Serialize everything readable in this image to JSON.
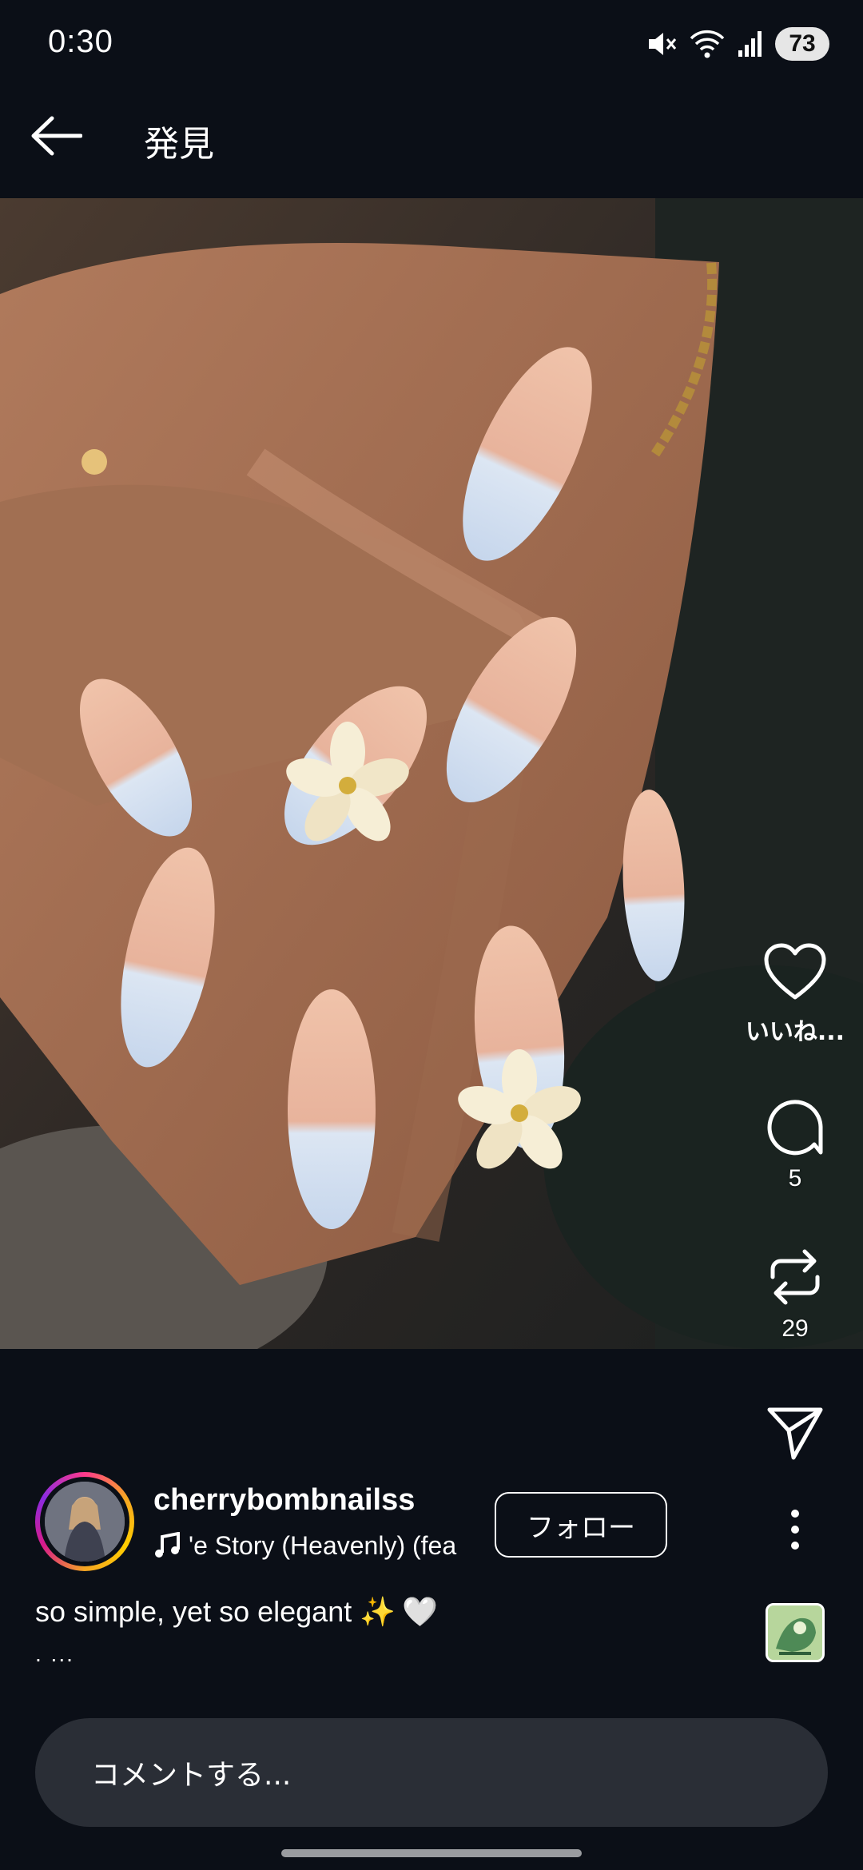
{
  "status_bar": {
    "time": "0:30",
    "battery": "73"
  },
  "header": {
    "title": "発見"
  },
  "actions": {
    "like_label": "いいね...",
    "comment_count": "5",
    "repost_count": "29"
  },
  "post": {
    "username": "cherrybombnailss",
    "music": "'e Story (Heavenly) (fea",
    "follow_label": "フォロー",
    "caption": "so simple, yet so elegant ✨",
    "caption_emoji": "🤍",
    "caption_more": ". ..."
  },
  "comment": {
    "placeholder": "コメントする..."
  },
  "colors": {
    "background": "#0b0f17",
    "comment_bar": "#2a2e36",
    "nail_tip": "#c9d8ec",
    "nail_base": "#e5b29a"
  }
}
